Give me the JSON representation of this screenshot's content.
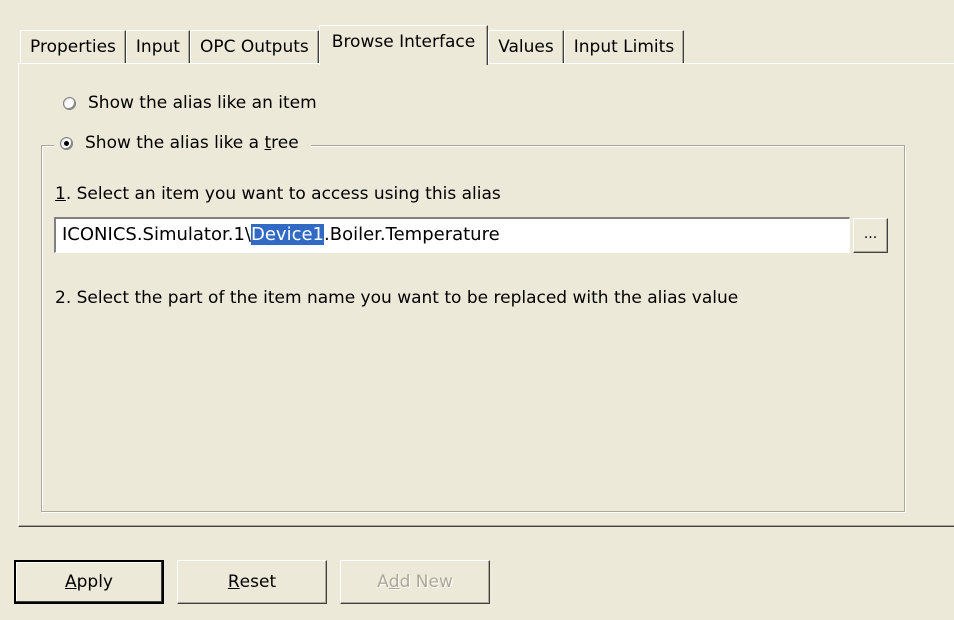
{
  "tabs": [
    {
      "label": "Properties",
      "active": false
    },
    {
      "label": "Input",
      "active": false
    },
    {
      "label": "OPC Outputs",
      "active": false
    },
    {
      "label": "Browse Interface",
      "active": true
    },
    {
      "label": "Values",
      "active": false
    },
    {
      "label": "Input Limits",
      "active": false
    }
  ],
  "options": {
    "item": {
      "label": "Show the alias like an item",
      "checked": false
    },
    "tree": {
      "label_pre": "Show the alias like a ",
      "label_acc": "t",
      "label_post": "ree",
      "checked": true
    }
  },
  "step1": {
    "acc": "1",
    "text": ". Select an item you want to access using this alias"
  },
  "path": {
    "before": "ICONICS.Simulator.1\\",
    "selected": "Device1",
    "after": ".Boiler.Temperature"
  },
  "browse_button": {
    "label": "..."
  },
  "step2": {
    "text": "2. Select the part of the item name you want to be replaced with the alias value"
  },
  "buttons": {
    "apply": {
      "acc": "A",
      "rest": "pply"
    },
    "reset": {
      "acc": "R",
      "rest": "eset"
    },
    "add_new": {
      "pre": "A",
      "acc": "d",
      "rest": "d New",
      "enabled": false
    }
  },
  "colors": {
    "dialog_bg": "#ece9d8",
    "selection": "#316ac5",
    "disabled_text": "#aca899"
  }
}
